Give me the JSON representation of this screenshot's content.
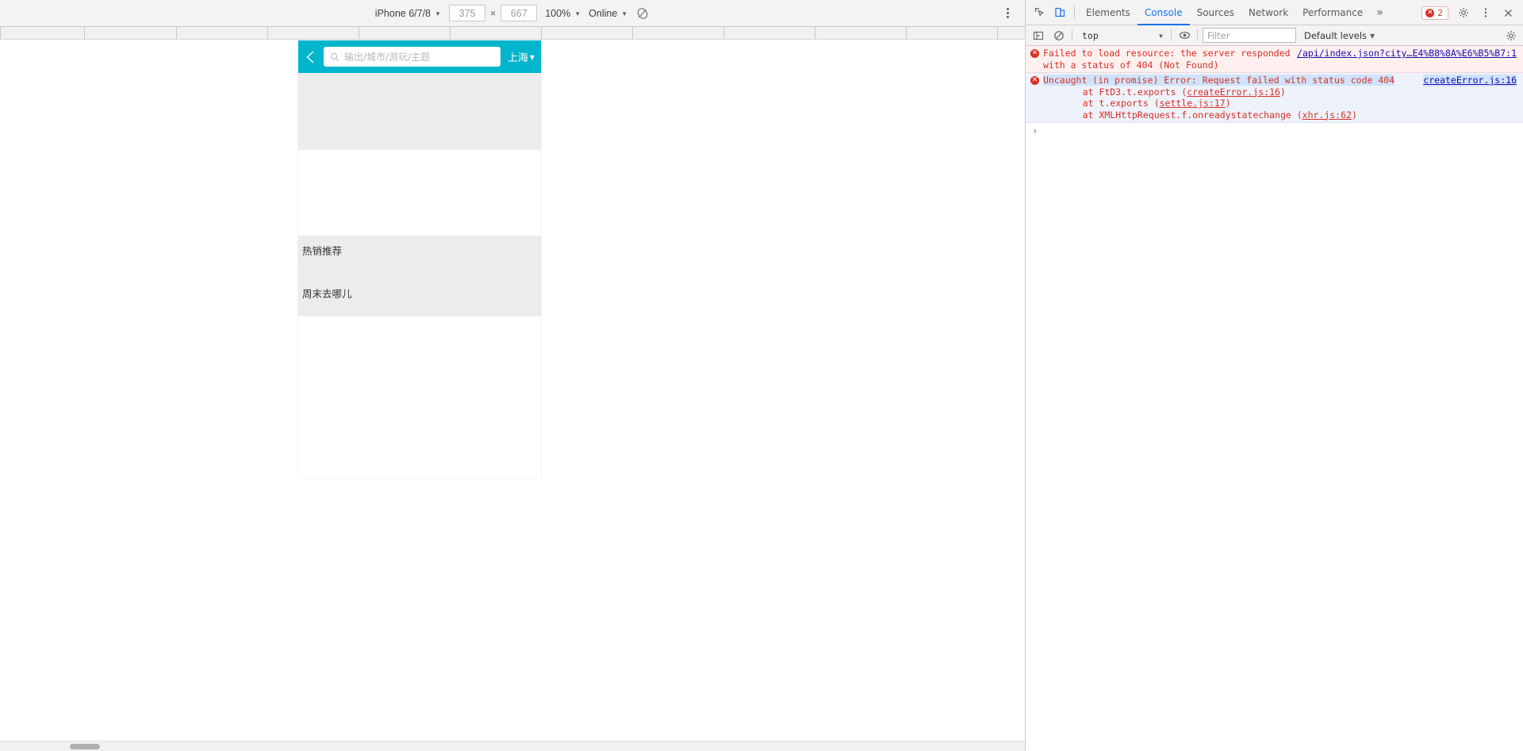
{
  "device_toolbar": {
    "device_name": "iPhone 6/7/8",
    "width": "375",
    "height": "667",
    "zoom": "100%",
    "throttling": "Online",
    "rotate_icon": "rotate-icon",
    "kebab_icon": "more-options-icon"
  },
  "phone_app": {
    "back_icon": "back-chevron-icon",
    "search": {
      "icon": "search-icon",
      "placeholder": "输出/城市/游玩/主题",
      "value": ""
    },
    "city": {
      "label": "上海",
      "caret": "▼"
    },
    "sections": [
      {
        "title": "热销推荐"
      },
      {
        "title": "周末去哪儿"
      }
    ]
  },
  "devtools": {
    "inspect_icon": "inspect-element-icon",
    "device_toggle_icon": "toggle-device-toolbar-icon",
    "tabs": [
      {
        "label": "Elements",
        "active": false
      },
      {
        "label": "Console",
        "active": true
      },
      {
        "label": "Sources",
        "active": false
      },
      {
        "label": "Network",
        "active": false
      },
      {
        "label": "Performance",
        "active": false
      }
    ],
    "more_tabs": "»",
    "error_badge": {
      "icon": "error-circle-icon",
      "count": "2"
    },
    "settings_icon": "settings-gear-icon",
    "dock_icon": "dock-side-icon",
    "close_icon": "close-icon",
    "console_toolbar": {
      "sidebar_icon": "console-sidebar-icon",
      "clear_icon": "clear-console-icon",
      "context": "top",
      "eye_icon": "live-expression-icon",
      "filter_placeholder": "Filter",
      "filter_value": "",
      "levels": "Default levels",
      "settings_icon": "console-settings-icon"
    },
    "messages": [
      {
        "icon": "error-circle-icon",
        "text_line1": "Failed to load resource: the server responded",
        "text_line2": "with a status of 404 (Not Found)",
        "source_link": "/api/index.json?city…E4%B8%8A%E6%B5%B7:1"
      },
      {
        "icon": "error-circle-icon",
        "headline": "Uncaught (in promise) Error: Request failed with status code 404",
        "source_link": "createError.js:16",
        "stack": [
          {
            "prefix": "    at FtD3.t.exports (",
            "link": "createError.js:16",
            "suffix": ")"
          },
          {
            "prefix": "    at t.exports (",
            "link": "settle.js:17",
            "suffix": ")"
          },
          {
            "prefix": "    at XMLHttpRequest.f.onreadystatechange (",
            "link": "xhr.js:62",
            "suffix": ")"
          }
        ]
      }
    ],
    "prompt": {
      "caret": "›",
      "value": ""
    }
  }
}
